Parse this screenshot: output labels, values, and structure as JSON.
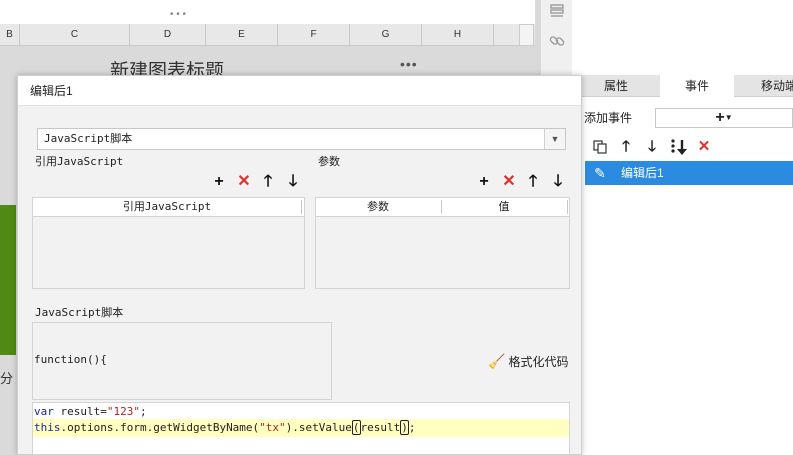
{
  "sheet": {
    "columns": [
      "B",
      "C",
      "D",
      "E",
      "F",
      "G",
      "H"
    ],
    "chart_title": "新建图表标题",
    "chart_menu": "•••",
    "partial_label": "分"
  },
  "right_panel": {
    "tabs": [
      {
        "label": "属性"
      },
      {
        "label": "事件"
      },
      {
        "label": "移动端"
      }
    ],
    "add_event_label": "添加事件",
    "add_event_button": "+",
    "events": [
      {
        "label": "编辑后1",
        "selected": true
      }
    ],
    "toolbar_icons": [
      "copy-icon",
      "move-up-icon",
      "move-down-icon",
      "move-to-bottom-icon",
      "delete-icon"
    ]
  },
  "dialog": {
    "title": "编辑后1",
    "script_type": "JavaScript脚本",
    "ref_section_label": "引用JavaScript",
    "ref_grid_header": "引用JavaScript",
    "param_section_label": "参数",
    "param_grid_headers": [
      "参数",
      "值"
    ],
    "js_section_label": "JavaScript脚本",
    "function_header": "function(){",
    "format_button": "格式化代码",
    "code_lines": [
      {
        "tokens": [
          {
            "text": "var",
            "type": "kw"
          },
          {
            "text": " result=",
            "type": "plain"
          },
          {
            "text": "\"123\"",
            "type": "str"
          },
          {
            "text": ";",
            "type": "plain"
          }
        ]
      },
      {
        "tokens": [
          {
            "text": "this",
            "type": "kw"
          },
          {
            "text": ".options.form.getWidgetByName(",
            "type": "plain"
          },
          {
            "text": "\"tx\"",
            "type": "str"
          },
          {
            "text": ").setValue",
            "type": "plain"
          },
          {
            "text": "(",
            "type": "cursor"
          },
          {
            "text": "result",
            "type": "plain"
          },
          {
            "text": ")",
            "type": "cursor"
          },
          {
            "text": ";",
            "type": "plain"
          }
        ]
      }
    ]
  },
  "colors": {
    "selection": "#2b8be0",
    "delete_red": "#e0302b",
    "keyword": "#1b24a8",
    "string": "#b22222",
    "highlight_line": "#ffffc0",
    "chart_bar_green": "#4e8a14"
  }
}
